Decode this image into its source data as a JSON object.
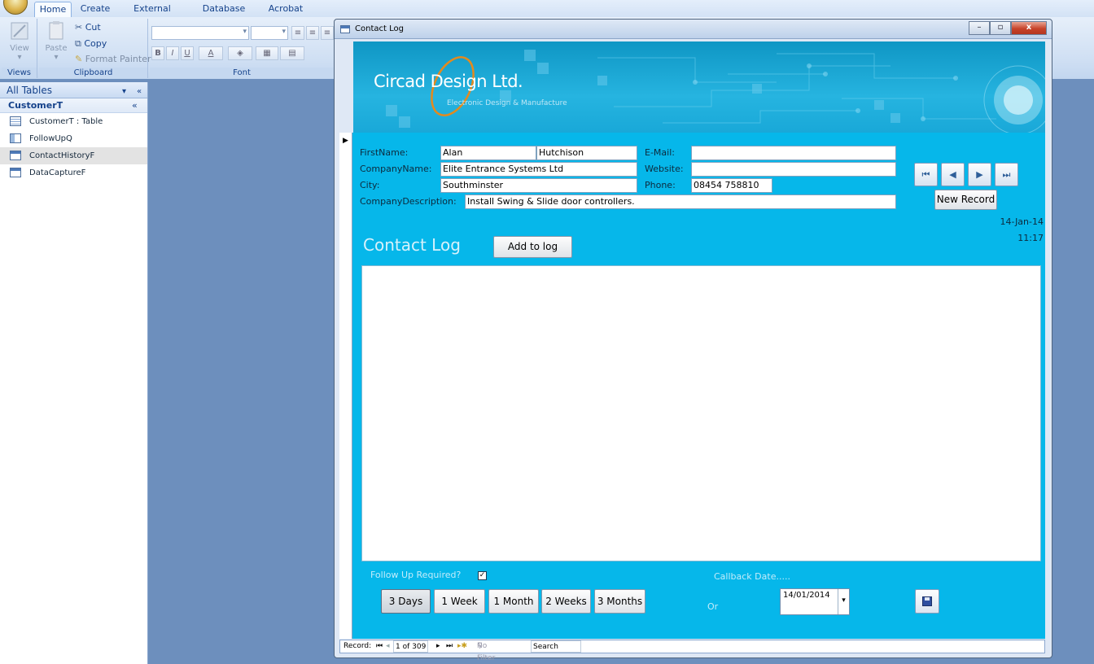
{
  "ribbon": {
    "tabs": [
      "Home",
      "Create",
      "External Data",
      "Database Tools",
      "Acrobat"
    ],
    "active_tab": "Home",
    "views": {
      "view_label": "View",
      "group_label": "Views"
    },
    "clipboard": {
      "paste_label": "Paste",
      "cut_label": "Cut",
      "copy_label": "Copy",
      "format_painter_label": "Format Painter",
      "group_label": "Clipboard"
    },
    "font": {
      "group_label": "Font",
      "bold": "B",
      "italic": "I",
      "underline": "U",
      "font_color": "A"
    }
  },
  "nav": {
    "header": "All Tables",
    "group": "CustomerT",
    "items": [
      {
        "label": "CustomerT : Table",
        "icon": "table-icon"
      },
      {
        "label": "FollowUpQ",
        "icon": "query-icon"
      },
      {
        "label": "ContactHistoryF",
        "icon": "form-icon"
      },
      {
        "label": "DataCaptureF",
        "icon": "form-icon"
      }
    ]
  },
  "window": {
    "title": "Contact Log",
    "min": "–",
    "max": "▫",
    "close": "x"
  },
  "header": {
    "logo": "Circad Design Ltd.",
    "tagline": "Electronic Design & Manufacture"
  },
  "form": {
    "labels": {
      "firstname": "FirstName:",
      "companyname": "CompanyName:",
      "city": "City:",
      "companydescription": "CompanyDescription:",
      "email": "E-Mail:",
      "website": "Website:",
      "phone": "Phone:"
    },
    "values": {
      "firstname": "Alan",
      "lastname": "Hutchison",
      "companyname": "Elite Entrance Systems Ltd",
      "city": "Southminster",
      "companydescription": "Install Swing & Slide door controllers.",
      "email": "",
      "website": "",
      "phone": "08454 758810"
    },
    "nav_buttons": {
      "first": "first-record-icon",
      "prev": "prev-record-icon",
      "next": "next-record-icon",
      "last": "last-record-icon"
    },
    "new_record": "New Record",
    "date": "14-Jan-14",
    "time": "11:17",
    "contact_log_title": "Contact Log",
    "add_to_log": "Add to log",
    "follow_up_label": "Follow Up Required?",
    "follow_up_checked": "✓",
    "callback_label": "Callback Date.....",
    "or_label": "Or",
    "callback_date": "14/01/2014",
    "quick_buttons": [
      "3 Days",
      "1 Week",
      "1 Month",
      "2 Weeks",
      "3 Months"
    ]
  },
  "recordbar": {
    "record_label": "Record:",
    "position": "1 of 309",
    "no_filter": "No Filter",
    "search": "Search"
  },
  "colors": {
    "form_bg": "#06b7ea",
    "header_bg": "#19a8d8",
    "desktop": "#6d8fbd"
  }
}
